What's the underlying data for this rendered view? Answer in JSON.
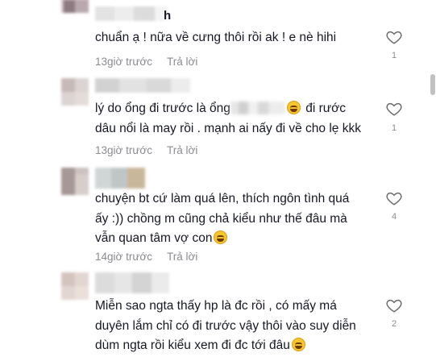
{
  "comments": [
    {
      "text_lines": [
        "chuẩn ạ ! nữa về cưng thôi rồi ak ! e nè hihi"
      ],
      "time": "13giờ trước",
      "reply": "Trả lời",
      "likes": "1",
      "name_tail": "h"
    },
    {
      "text_before_redact": "lý do ổng đi trước là ổng",
      "text_after_emoji": " đi rước",
      "text_line2": "dâu nổi là may rồi . mạnh ai nấy đi về cho lẹ kkk",
      "time": "13giờ trước",
      "reply": "Trả lời",
      "likes": "1"
    },
    {
      "text_lines": [
        "chuyện bt cứ làm quá lên, thích ngôn tình quá",
        "ấy :)) chồng m cũng chả kiểu như thế đâu mà",
        "vẫn quan tâm vợ con"
      ],
      "time": "14giờ trước",
      "reply": "Trả lời",
      "likes": "4"
    },
    {
      "text_lines": [
        "Miễn sao ngta thấy hp là đc rồi , có mấy má",
        "duyên lắm chỉ có đi trước vậy thôi vào suy diễn",
        "dùm ngta rồi kiểu xem đi đc tới đâu"
      ],
      "time": "",
      "reply": "",
      "likes": "2"
    }
  ],
  "colors": {
    "text": "#161823",
    "meta": "#8a8b91",
    "emoji": "#f7c52e"
  },
  "icons": {
    "like": "heart-outline-icon",
    "emoji": "laughing-emoji-icon"
  }
}
